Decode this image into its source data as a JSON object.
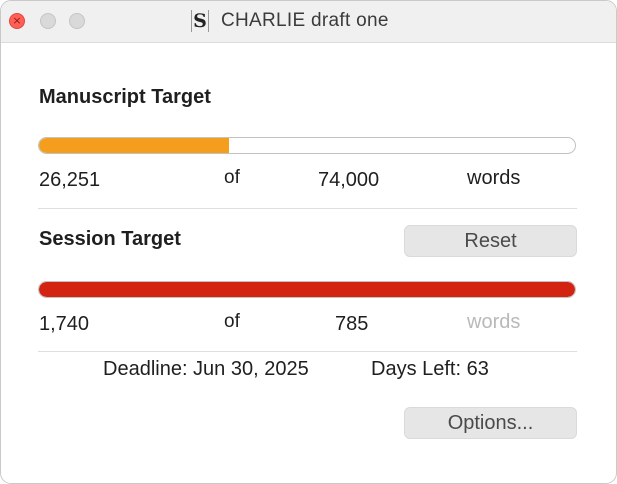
{
  "window": {
    "title": "CHARLIE draft one",
    "icon": "scrivener-doc-icon"
  },
  "manuscript": {
    "heading": "Manuscript Target",
    "current": "26,251",
    "of": "of",
    "target": "74,000",
    "unit": "words",
    "progress": 0.355,
    "bar_color": "#f59e1d"
  },
  "session": {
    "heading": "Session Target",
    "reset_label": "Reset",
    "current": "1,740",
    "of": "of",
    "target": "785",
    "unit": "words",
    "progress": 1.0,
    "bar_color": "#d22410"
  },
  "deadline": {
    "text": "Deadline: Jun 30, 2025",
    "days_left": "Days Left: 63"
  },
  "options_label": "Options..."
}
